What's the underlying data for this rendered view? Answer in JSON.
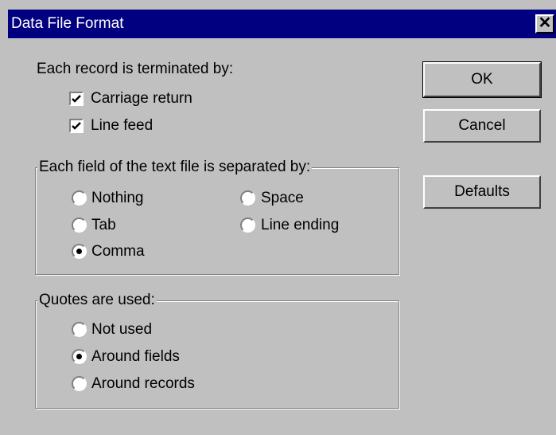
{
  "window": {
    "title": "Data File Format",
    "close_glyph": "✕"
  },
  "record_section": {
    "label": "Each record is terminated by:",
    "options": [
      {
        "label": "Carriage return",
        "checked": true
      },
      {
        "label": "Line feed",
        "checked": true
      }
    ]
  },
  "field_separator": {
    "title": "Each field of the text file is separated by:",
    "options": [
      {
        "label": "Nothing",
        "selected": false
      },
      {
        "label": "Space",
        "selected": false
      },
      {
        "label": "Tab",
        "selected": false
      },
      {
        "label": "Line ending",
        "selected": false
      },
      {
        "label": "Comma",
        "selected": true
      }
    ]
  },
  "quotes": {
    "title": "Quotes are used:",
    "options": [
      {
        "label": "Not used",
        "selected": false
      },
      {
        "label": "Around fields",
        "selected": true
      },
      {
        "label": "Around records",
        "selected": false
      }
    ]
  },
  "buttons": {
    "ok": "OK",
    "cancel": "Cancel",
    "defaults": "Defaults"
  }
}
